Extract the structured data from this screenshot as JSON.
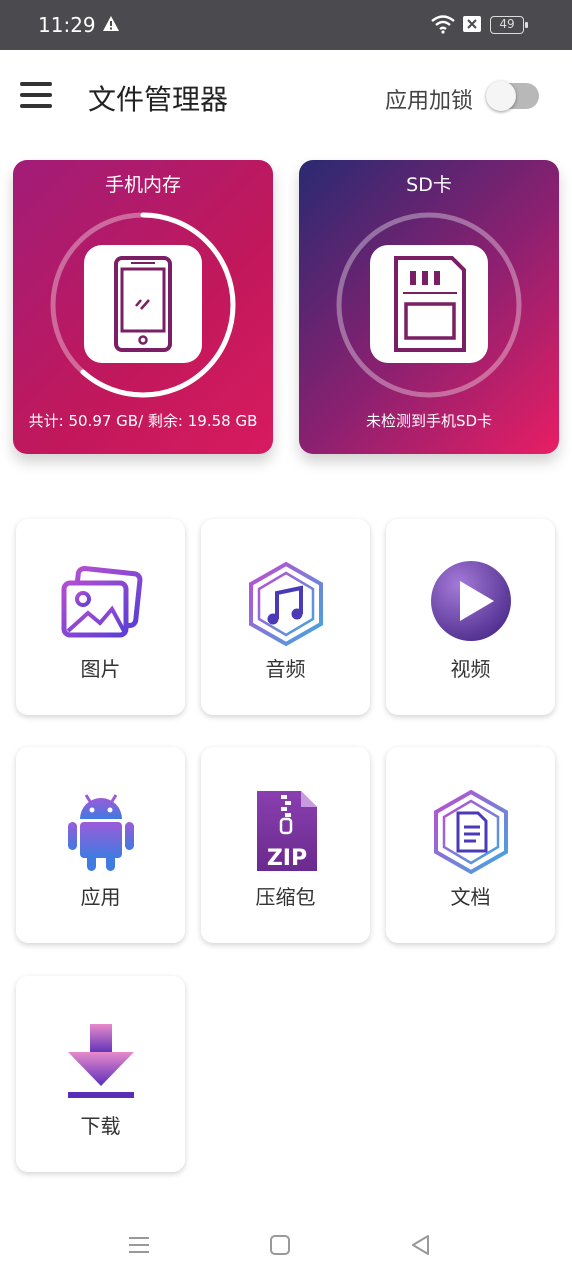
{
  "status_bar": {
    "time": "11:29",
    "battery": "49"
  },
  "app_bar": {
    "title": "文件管理器",
    "lock_label": "应用加锁",
    "lock_enabled": false
  },
  "storage": {
    "phone": {
      "title": "手机内存",
      "summary": "共计: 50.97 GB/ 剩余: 19.58 GB",
      "used_fraction": 0.616
    },
    "sd": {
      "title": "SD卡",
      "summary": "未检测到手机SD卡"
    }
  },
  "categories": [
    {
      "label": "图片",
      "icon": "image-icon"
    },
    {
      "label": "音频",
      "icon": "music-icon"
    },
    {
      "label": "视频",
      "icon": "play-icon"
    },
    {
      "label": "应用",
      "icon": "android-icon"
    },
    {
      "label": "压缩包",
      "icon": "zip-icon"
    },
    {
      "label": "文档",
      "icon": "document-icon"
    },
    {
      "label": "下载",
      "icon": "download-icon"
    }
  ],
  "colors": {
    "status_bar": "#4a4a4f",
    "accent_purple": "#7b4fd6",
    "phone_card": "#c2185b",
    "sd_card": "#8e2070"
  }
}
